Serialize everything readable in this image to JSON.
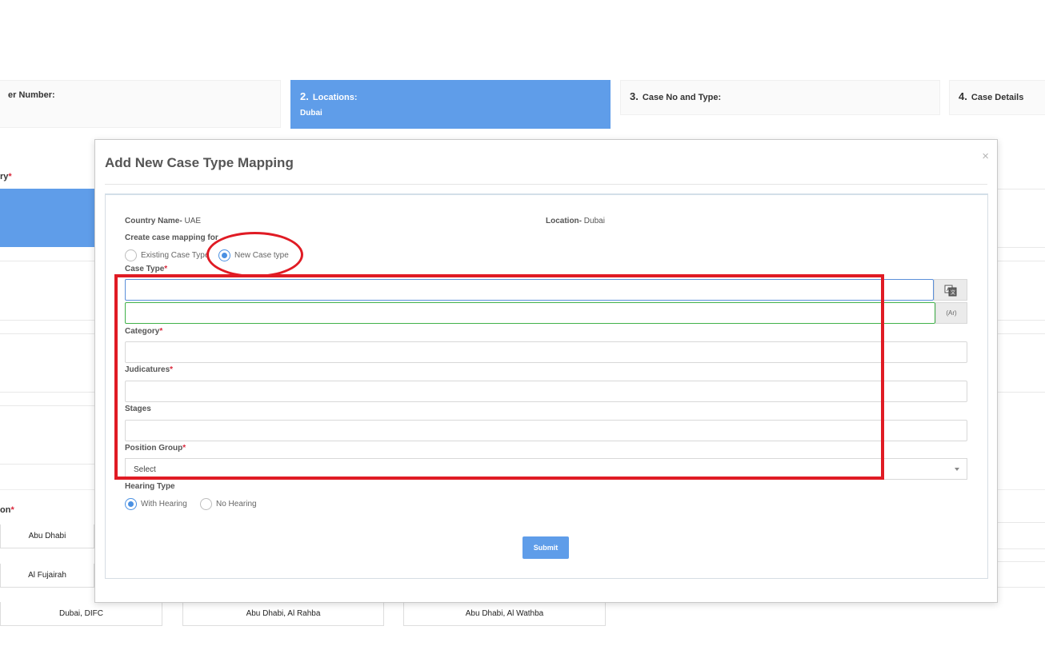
{
  "stepper": {
    "step1": {
      "label": "er Number:"
    },
    "step2": {
      "num": "2.",
      "label": "Locations:",
      "sub": "Dubai"
    },
    "step3": {
      "num": "3.",
      "label": "Case No and Type:"
    },
    "step4": {
      "num": "4.",
      "label": "Case Details"
    }
  },
  "background": {
    "category_label": "ry",
    "location_label": "on",
    "chips": [
      "Abu Dhabi",
      "Al Fujairah",
      "Dubai, DIFC",
      "Abu Dhabi, Al Rahba",
      "Abu Dhabi, Al Wathba"
    ]
  },
  "modal": {
    "title": "Add New Case Type Mapping",
    "close": "×",
    "country_key": "Country Name-",
    "country_value": "UAE",
    "location_key": "Location-",
    "location_value": "Dubai",
    "mapping_label": "Create case mapping for",
    "mapping_options": {
      "existing": "Existing Case Type",
      "new": "New Case type"
    },
    "mapping_selected": "new",
    "fields": {
      "case_type_label": "Case Type",
      "case_type_value": "",
      "case_type_ar_value": "",
      "ar_addon": "(Ar)",
      "category_label": "Category",
      "category_value": "",
      "judicatures_label": "Judicatures",
      "judicatures_value": "",
      "stages_label": "Stages",
      "stages_value": "",
      "position_group_label": "Position Group",
      "position_group_value": "Select"
    },
    "required_mark": "*",
    "hearing": {
      "label": "Hearing Type",
      "with": "With Hearing",
      "without": "No Hearing",
      "selected": "with"
    },
    "submit_label": "Submit"
  },
  "colors": {
    "accent": "#5f9de9",
    "annotation": "#e01b24",
    "required": "#d9273b"
  }
}
